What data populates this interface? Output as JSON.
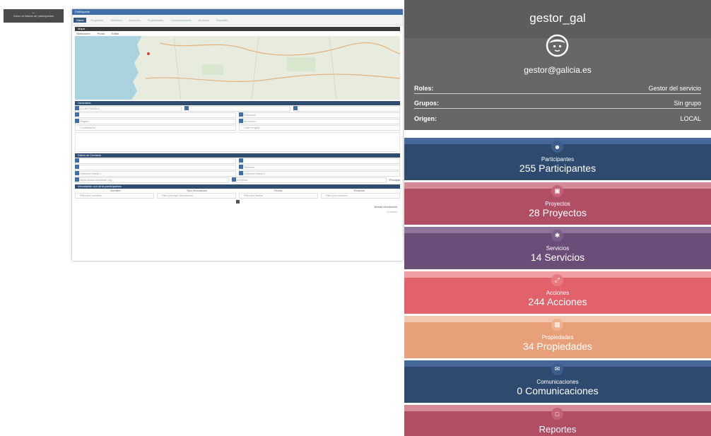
{
  "back_button": {
    "label": "Volver al listado de participantes"
  },
  "window": {
    "title": "Participante",
    "tabs": [
      "Datos",
      "Proyectos",
      "Servicios",
      "Acciones",
      "Propiedades",
      "Comunicaciones",
      "Archivos",
      "Reportes"
    ],
    "map_panel": "Mapa",
    "map_toolbar": {
      "left": "Seleccione",
      "mode": "Punto",
      "edit": "Editar"
    },
    "general_panel": "Generales",
    "general_fields": {
      "entidad": "A CAPITANÍA A",
      "sector": "Provincia",
      "region": "Región",
      "ubicacion": "Municipio",
      "localizacion": "Localización",
      "lider": "Líder lengua"
    },
    "contact_panel": "Datos de Contacto",
    "contact_fields": {
      "telefono": "Teléfono",
      "direccion1": "Dirección fiscal 1",
      "direccion2": "Dirección fiscal 2",
      "web": "https://www.aiinstitute.org",
      "email": "info@aii",
      "principal": "Principal"
    },
    "relation_panel": "Vinculación con otros participantes",
    "relation_headers": [
      "Nombre",
      "Tipo Vinculación",
      "Fecha",
      "Relación"
    ],
    "relation_filters": [
      "Filtro por nombre",
      "Filtro por tipo vinculación",
      "Filtro por fecha",
      "Filtro por relación"
    ],
    "pager": "1",
    "add_button": "Añadir vinculación",
    "save_button": "Guardar"
  },
  "profile": {
    "username": "gestor_gal",
    "email": "gestor@galicia.es",
    "rows": [
      {
        "key": "Roles:",
        "value": "Gestor del servicio"
      },
      {
        "key": "Grupos:",
        "value": "Sin grupo"
      },
      {
        "key": "Origen:",
        "value": "LOCAL"
      }
    ]
  },
  "cards": [
    {
      "icon": "users-icon",
      "label": "Participantes",
      "value": "255 Participantes",
      "color": "#2e4a6e",
      "band": "#45679a",
      "ic": "#3e5f8e"
    },
    {
      "icon": "briefcase-icon",
      "label": "Proyectos",
      "value": "28 Proyectos",
      "color": "#b04f64",
      "band": "#d58a98",
      "ic": "#c46378"
    },
    {
      "icon": "network-icon",
      "label": "Servicios",
      "value": "14 Servicios",
      "color": "#6a4e78",
      "band": "#8e7498",
      "ic": "#7b5f89"
    },
    {
      "icon": "expand-icon",
      "label": "Acciones",
      "value": "244 Acciones",
      "color": "#e2626b",
      "band": "#f0a0a5",
      "ic": "#e97a82"
    },
    {
      "icon": "building-icon",
      "label": "Propiedades",
      "value": "34 Propiedades",
      "color": "#e8a07a",
      "band": "#f3c7ae",
      "ic": "#eeb08f"
    },
    {
      "icon": "envelope-icon",
      "label": "Comunicaciones",
      "value": "0 Comunicaciones",
      "color": "#2e4a6e",
      "band": "#45679a",
      "ic": "#3e5f8e"
    },
    {
      "icon": "report-icon",
      "label": "Reportes",
      "value": "",
      "color": "#b04f64",
      "band": "#d58a98",
      "ic": "#c46378"
    }
  ]
}
